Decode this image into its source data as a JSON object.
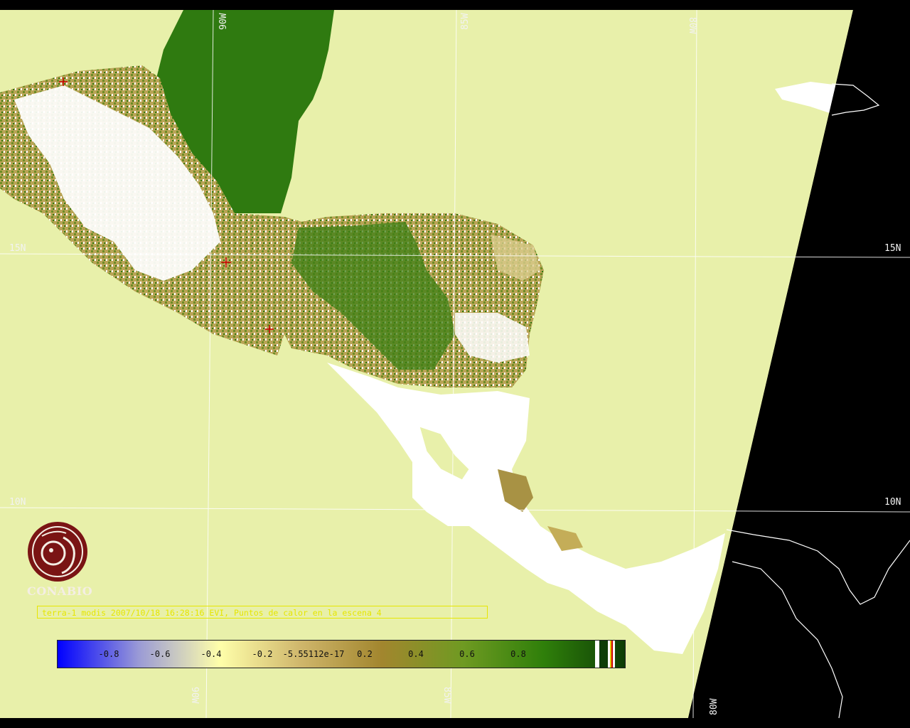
{
  "map": {
    "grid_labels": {
      "lon_top": [
        "90W",
        "85W",
        "80W"
      ],
      "lon_bottom": [
        "90W",
        "85W",
        "80W"
      ],
      "lat_left": [
        "15N",
        "10N"
      ],
      "lat_right": [
        "15N",
        "10N"
      ]
    }
  },
  "logo": {
    "text": "CONABIO"
  },
  "caption": {
    "text": "terra-1 modis 2007/10/18 16:28:16 EVI, Puntos de calor en la escena 4"
  },
  "colorbar": {
    "ticks": [
      {
        "value": -0.8,
        "label": "-0.8"
      },
      {
        "value": -0.6,
        "label": "-0.6"
      },
      {
        "value": -0.4,
        "label": "-0.4"
      },
      {
        "value": -0.2,
        "label": "-0.2"
      },
      {
        "value": 0,
        "label": "-5.55112e-17"
      },
      {
        "value": 0.2,
        "label": "0.2"
      },
      {
        "value": 0.4,
        "label": "0.4"
      },
      {
        "value": 0.6,
        "label": "0.6"
      },
      {
        "value": 0.8,
        "label": "0.8"
      }
    ],
    "colors": [
      "#0000ff",
      "#9a9ad6",
      "#ffffaa",
      "#cfb66b",
      "#a2862e",
      "#6f9a22",
      "#2f7f0a",
      "#0e3d06"
    ]
  },
  "colors": {
    "ocean": "#e8f0aa",
    "no_data": "#000000",
    "cloud": "#ffffff",
    "vegetation_dense": "#2f7a10",
    "vegetation_sparse": "#b5a050",
    "hotspot": "#cc0000",
    "grid": "#ffffff"
  }
}
